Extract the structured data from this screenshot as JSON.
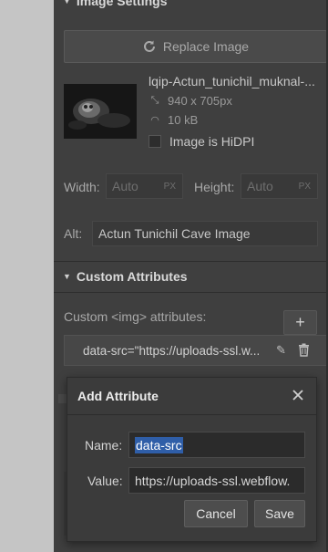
{
  "image_settings": {
    "section_title": "Image Settings",
    "replace_label": "Replace Image",
    "filename": "lqip-Actun_tunichil_muknal-...",
    "dimensions": "940 x 705px",
    "filesize": "10 kB",
    "hidpi_label": "Image is HiDPI",
    "hidpi_checked": false,
    "width_label": "Width:",
    "width_placeholder": "Auto",
    "width_unit": "PX",
    "height_label": "Height:",
    "height_placeholder": "Auto",
    "height_unit": "PX",
    "alt_label": "Alt:",
    "alt_value": "Actun Tunichil Cave Image"
  },
  "custom_attributes": {
    "section_title": "Custom Attributes",
    "label": "Custom <img> attributes:",
    "add_symbol": "+",
    "items": [
      {
        "text": "data-src=\"https://uploads-ssl.w..."
      }
    ]
  },
  "dialog": {
    "title": "Add Attribute",
    "name_label": "Name:",
    "name_value": "data-src",
    "value_label": "Value:",
    "value_value": "https://uploads-ssl.webflow.",
    "cancel_label": "Cancel",
    "save_label": "Save"
  },
  "icons": {
    "replace": "refresh-icon",
    "dimensions": "resize-icon",
    "filesize": "gauge-icon",
    "edit": "pencil-icon",
    "delete": "trash-icon",
    "close": "close-icon"
  },
  "colors": {
    "panel_bg": "#3f3f3f",
    "selection": "#2f5ea8",
    "dialog_bg": "#3b3b3b"
  }
}
